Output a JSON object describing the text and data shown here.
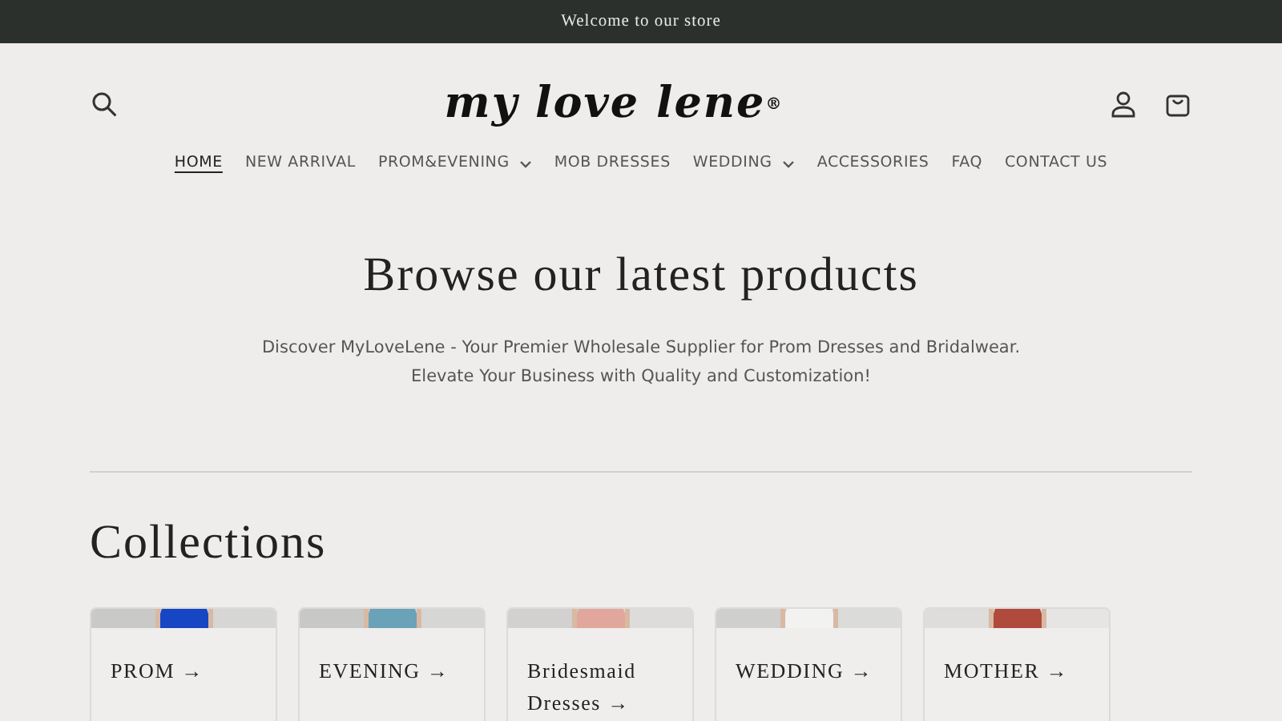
{
  "announcement": "Welcome to our store",
  "header": {
    "logo": "my love lene$^{®}$"
  },
  "nav": [
    {
      "label": "HOME",
      "selected": true,
      "dropdown": false
    },
    {
      "label": "NEW ARRIVAL",
      "selected": false,
      "dropdown": false
    },
    {
      "label": "PROM&EVENING",
      "selected": false,
      "dropdown": true
    },
    {
      "label": "MOB DRESSES",
      "selected": false,
      "dropdown": false
    },
    {
      "label": "WEDDING",
      "selected": false,
      "dropdown": true
    },
    {
      "label": "ACCESSORIES",
      "selected": false,
      "dropdown": false
    },
    {
      "label": "FAQ",
      "selected": false,
      "dropdown": false
    },
    {
      "label": "CONTACT US",
      "selected": false,
      "dropdown": false
    }
  ],
  "hero": {
    "title": "Browse our latest products",
    "text": "Discover MyLoveLene - Your Premier Wholesale Supplier for Prom Dresses and Bridalwear. Elevate Your Business with Quality and Customization!"
  },
  "collections": {
    "title": "Collections",
    "items": [
      {
        "label": "PROM →",
        "kind": "picture"
      },
      {
        "label": "EVENING →",
        "kind": "picture"
      },
      {
        "label": "Bridesmaid Dresses →",
        "kind": "picture"
      },
      {
        "label": "WEDDING →",
        "kind": "picture"
      },
      {
        "label": "MOTHER →",
        "kind": "picture"
      }
    ]
  }
}
